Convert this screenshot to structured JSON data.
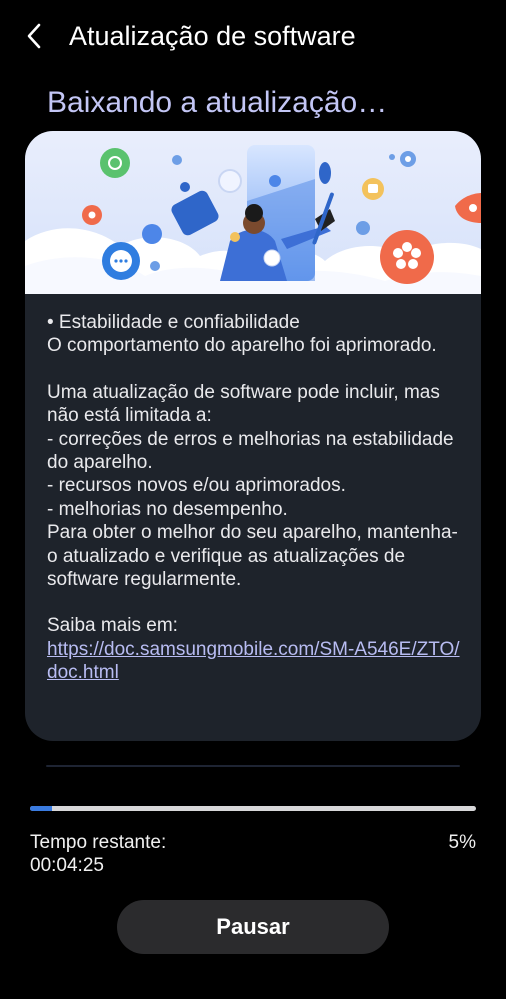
{
  "app_bar": {
    "title": "Atualização de software"
  },
  "heading": "Baixando a atualização…",
  "release_notes": {
    "p1": "• Estabilidade e confiabilidade\nO comportamento do aparelho foi aprimorado.",
    "p2": "Uma atualização de software pode incluir, mas não está limitada a:\n - correções de erros e melhorias na estabilidade do aparelho.\n - recursos novos e/ou aprimorados.\n - melhorias no desempenho.\nPara obter o melhor do seu aparelho, mantenha-o atualizado e verifique as atualizações de software regularmente.",
    "more_info_label": "Saiba mais em:",
    "link": "https://doc.samsungmobile.com/SM-A546E/ZTO/doc.html"
  },
  "download": {
    "progress_fraction": 0.05,
    "remaining_label": "Tempo restante:",
    "remaining_time": "00:04:25",
    "percent_text": "5%"
  },
  "pause_button": {
    "label": "Pausar"
  },
  "colors": {
    "accent_heading": "#c3c6f5",
    "progress": "#3a7be0",
    "card_bg": "#1e232b",
    "link": "#b8bcf2"
  }
}
